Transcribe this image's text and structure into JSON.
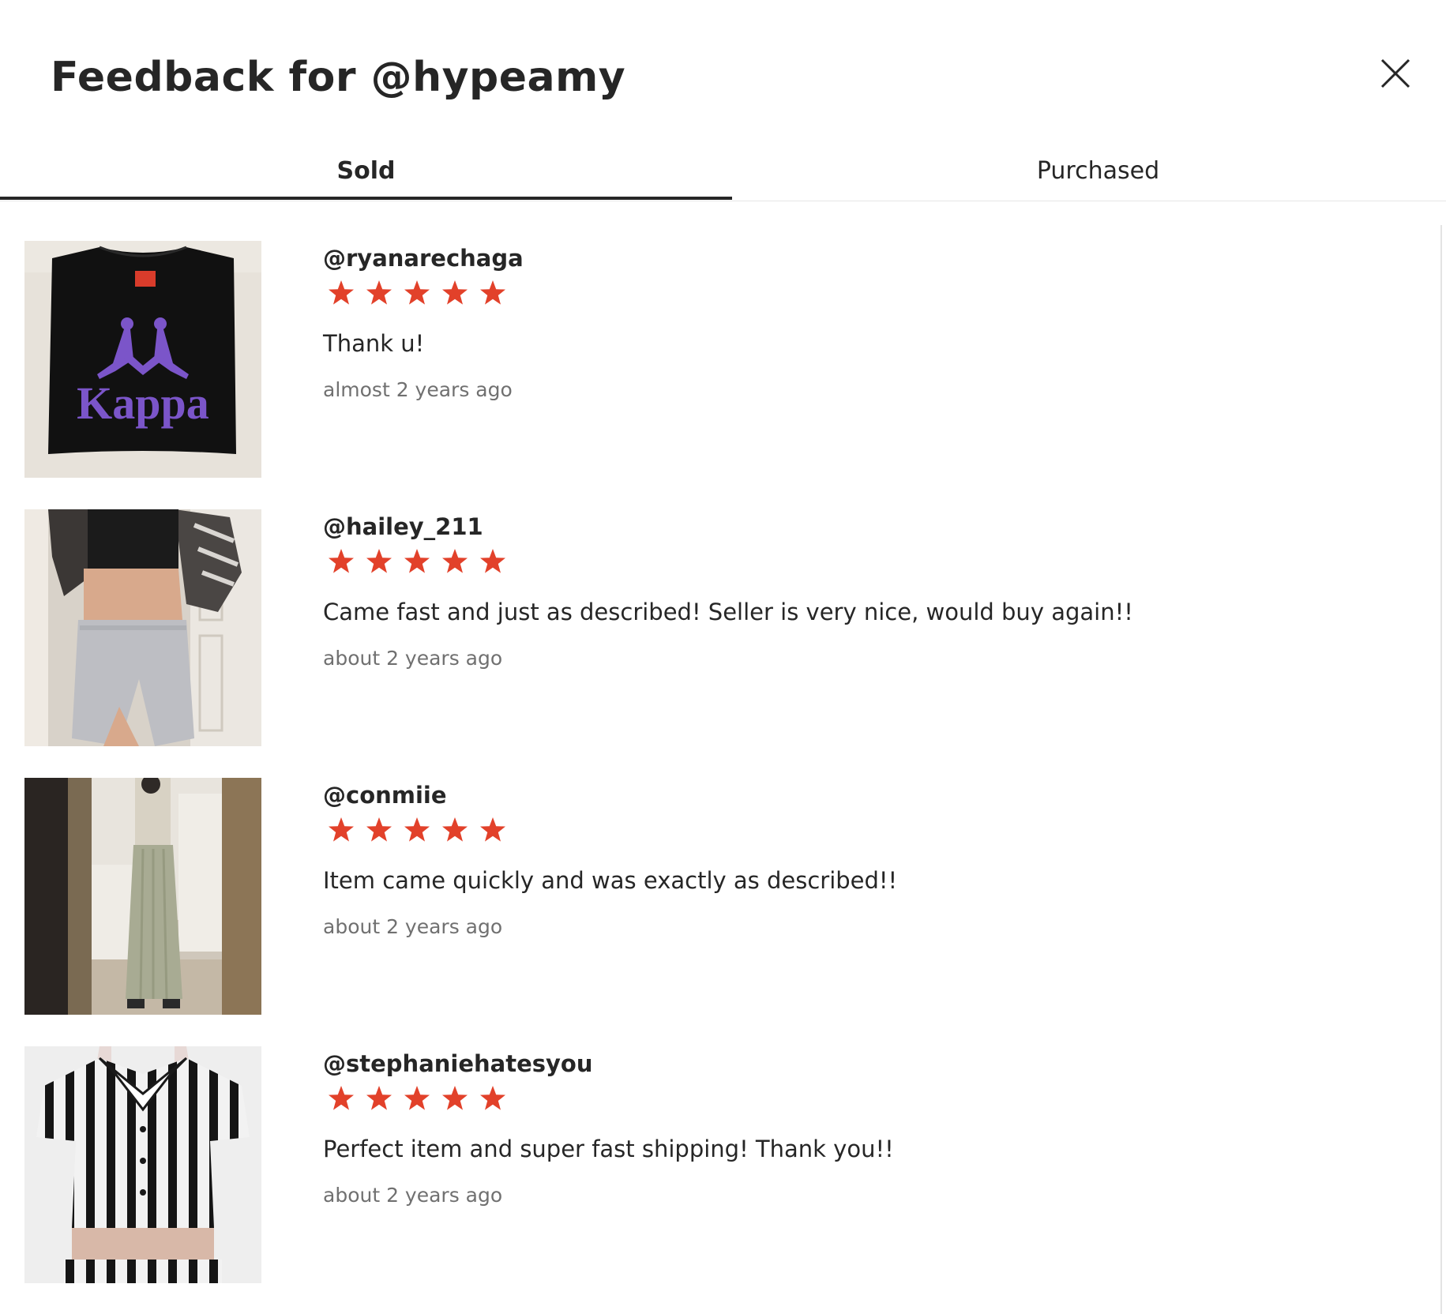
{
  "modal": {
    "title": "Feedback for @hypeamy"
  },
  "tabs": [
    {
      "label": "Sold",
      "active": true
    },
    {
      "label": "Purchased",
      "active": false
    }
  ],
  "colors": {
    "star": "#e2412a",
    "text": "#262626",
    "muted": "#707070",
    "tab_underline": "#262626"
  },
  "feedback": [
    {
      "user": "@ryanarechaga",
      "rating": 5,
      "comment": "Thank u!",
      "time": "almost 2 years ago",
      "photo": "black Kappa t-shirt with purple logo"
    },
    {
      "user": "@hailey_211",
      "rating": 5,
      "comment": "Came fast and just as described! Seller is very nice, would buy again!!",
      "time": "about 2 years ago",
      "photo": "grey running shorts with black crop top"
    },
    {
      "user": "@conmiie",
      "rating": 5,
      "comment": "Item came quickly and was exactly as described!!",
      "time": "about 2 years ago",
      "photo": "sage pleated wide-leg trousers mirror selfie"
    },
    {
      "user": "@stephaniehatesyou",
      "rating": 5,
      "comment": "Perfect item and super fast shipping! Thank you!!",
      "time": "about 2 years ago",
      "photo": "black and white striped collared crop top"
    }
  ]
}
